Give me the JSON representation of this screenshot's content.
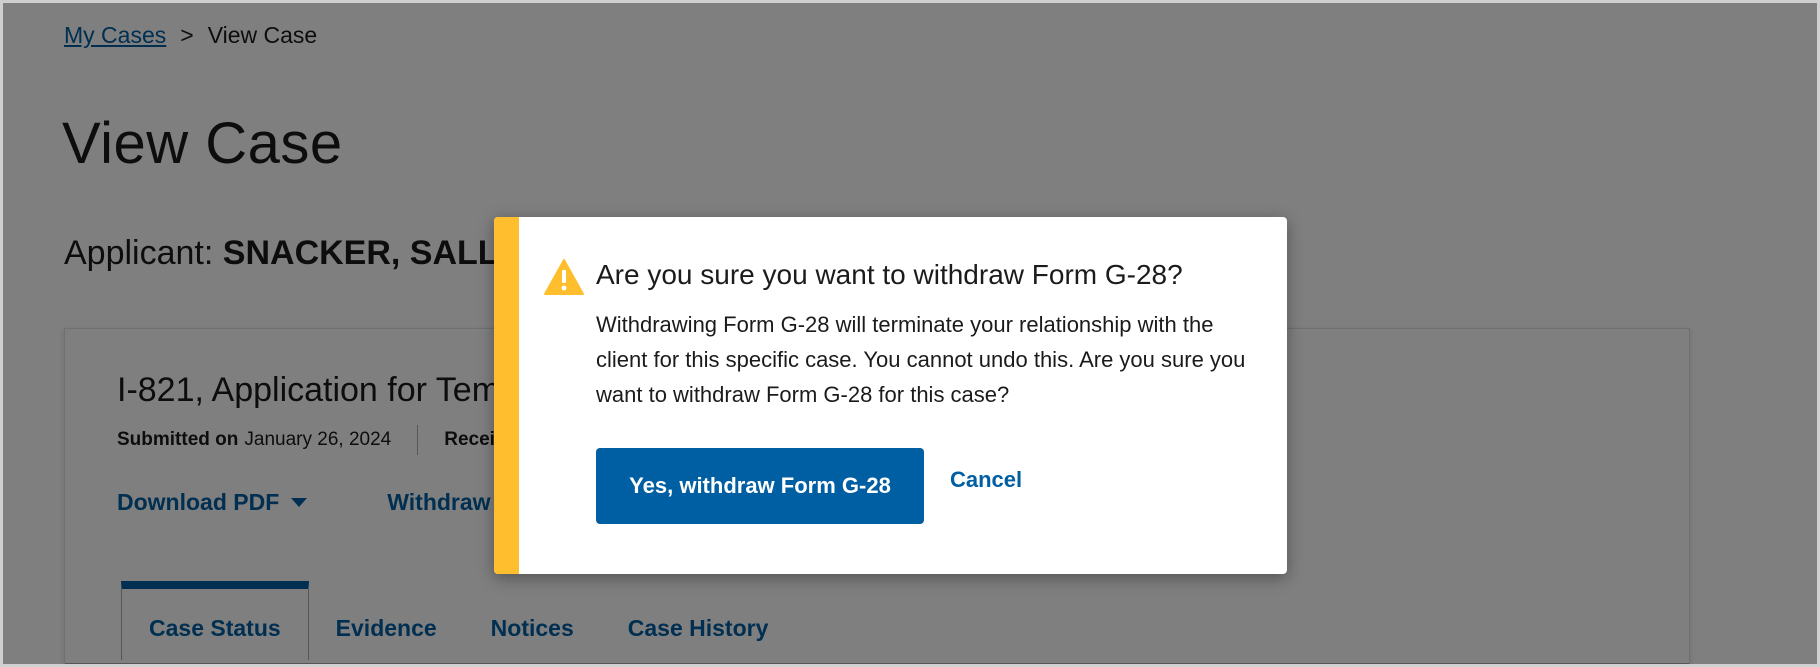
{
  "breadcrumb": {
    "parent_label": "My Cases",
    "separator": ">",
    "current_label": "View Case"
  },
  "page": {
    "title": "View Case"
  },
  "applicant": {
    "label": "Applicant:",
    "name": "SNACKER, SALLY"
  },
  "case": {
    "title": "I-821, Application for Temporary Protected Status",
    "submitted_label": "Submitted on",
    "submitted_date": "January 26, 2024",
    "received_label": "Received on",
    "received_value": "",
    "actions": {
      "download_pdf_label": "Download PDF",
      "withdraw_label": "Withdraw Form G-28"
    },
    "tabs": [
      {
        "label": "Case Status",
        "active": true
      },
      {
        "label": "Evidence",
        "active": false
      },
      {
        "label": "Notices",
        "active": false
      },
      {
        "label": "Case History",
        "active": false
      }
    ]
  },
  "modal": {
    "heading": "Are you sure you want to withdraw Form G-28?",
    "body": "Withdrawing Form G-28 will terminate your relationship with the client for this specific case. You cannot undo this. Are you sure you want to withdraw Form G-28 for this case?",
    "confirm_label": "Yes, withdraw Form G-28",
    "cancel_label": "Cancel",
    "icon": "warning-icon"
  },
  "colors": {
    "primary": "#005ea2",
    "warning_accent": "#ffbe2e",
    "overlay": "rgba(0,0,0,0.5)"
  }
}
